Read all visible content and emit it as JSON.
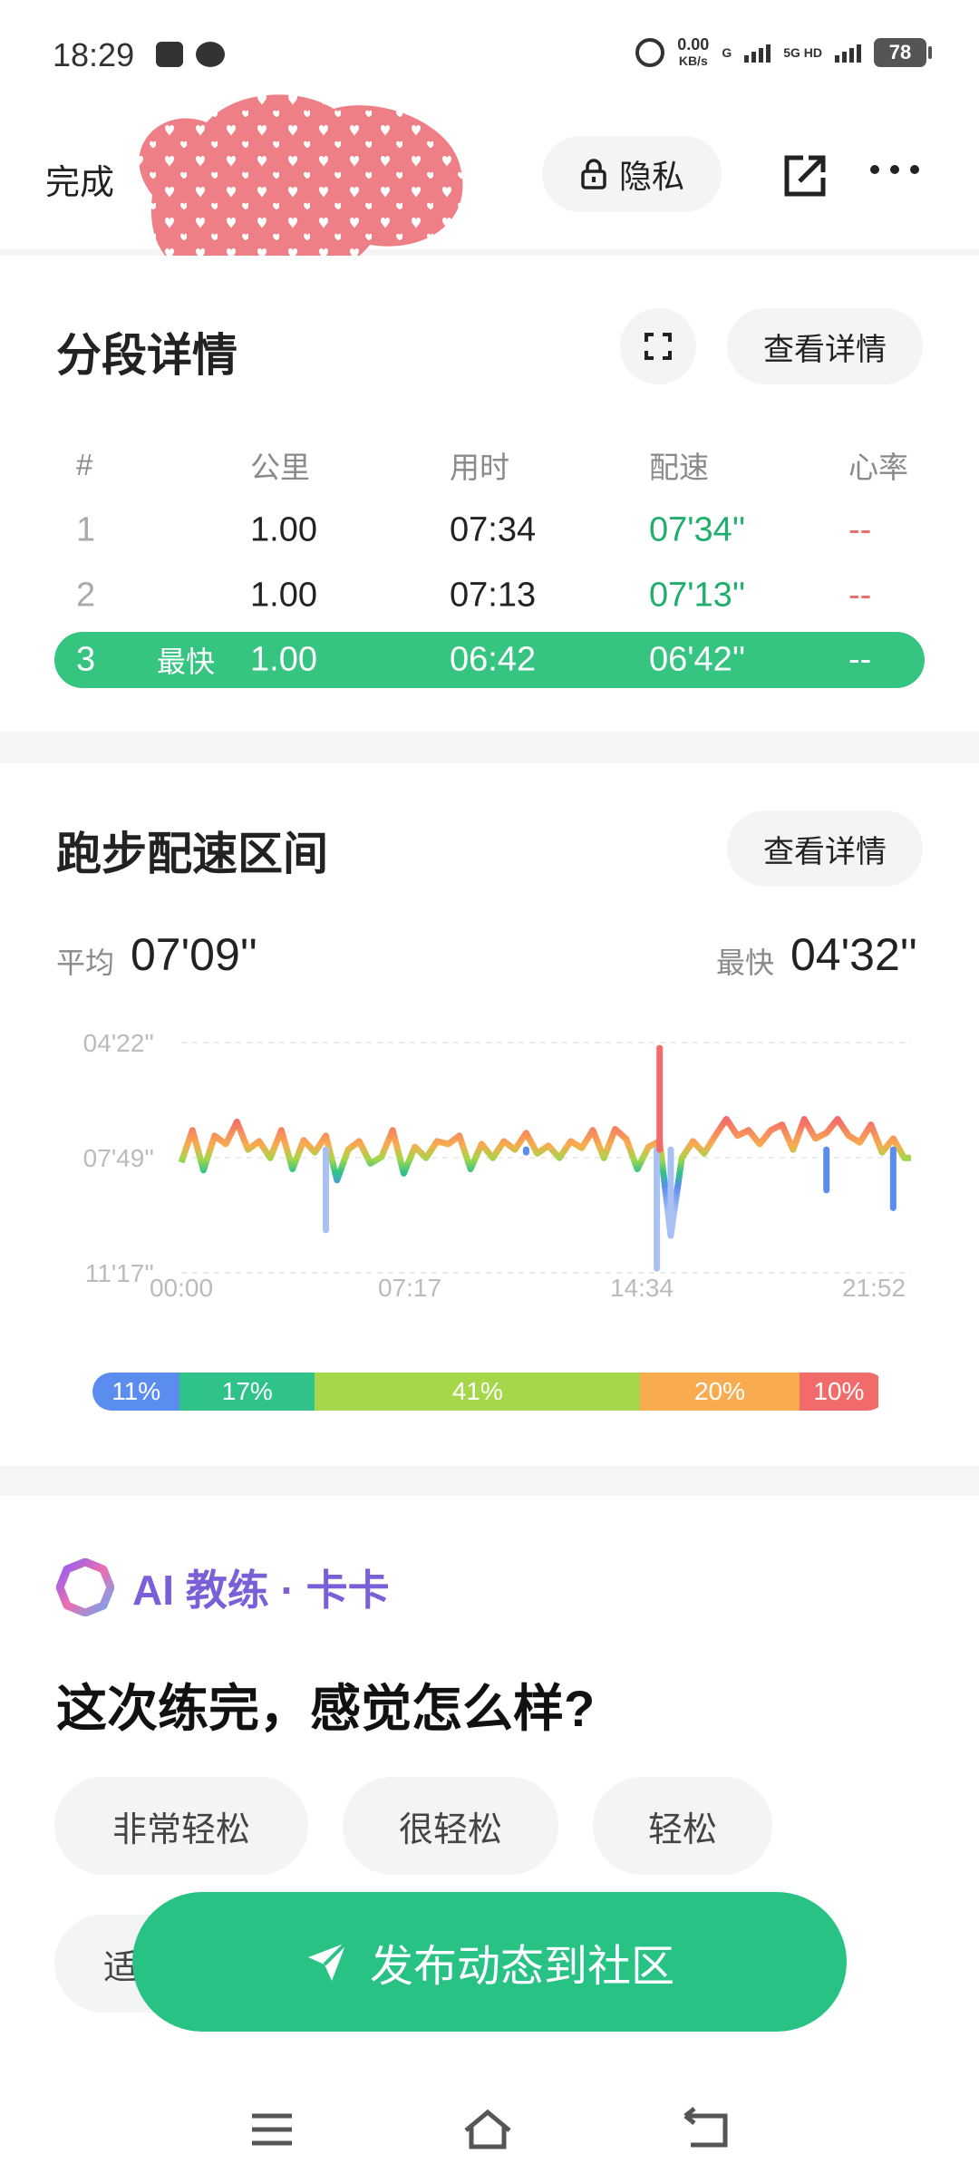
{
  "status_bar": {
    "time": "18:29",
    "speed_value": "0.00",
    "speed_unit": "KB/s",
    "net_left": "G",
    "net_right": "5G HD",
    "battery": "78"
  },
  "top_nav": {
    "done_label": "完成",
    "privacy_label": "隐私",
    "icons": [
      "lock-icon",
      "share-icon",
      "more-icon"
    ]
  },
  "segments": {
    "title": "分段详情",
    "detail_label": "查看详情",
    "headers": [
      "#",
      "公里",
      "用时",
      "配速",
      "心率"
    ],
    "rows": [
      {
        "index": "1",
        "tag": "",
        "distance": "1.00",
        "time": "07:34",
        "pace": "07'34''",
        "heart_rate": "--"
      },
      {
        "index": "2",
        "tag": "",
        "distance": "1.00",
        "time": "07:13",
        "pace": "07'13''",
        "heart_rate": "--"
      },
      {
        "index": "3",
        "tag": "最快",
        "distance": "1.00",
        "time": "06:42",
        "pace": "06'42''",
        "heart_rate": "--"
      }
    ]
  },
  "pace_zone": {
    "title": "跑步配速区间",
    "detail_label": "查看详情",
    "avg_label": "平均",
    "avg_value": "07'09''",
    "best_label": "最快",
    "best_value": "04'32''",
    "zones": [
      {
        "label": "11%",
        "percent": 11,
        "color": "#5b8def"
      },
      {
        "label": "17%",
        "percent": 17,
        "color": "#2fc38a"
      },
      {
        "label": "41%",
        "percent": 41,
        "color": "#a6d64a"
      },
      {
        "label": "20%",
        "percent": 20,
        "color": "#f9ab4f"
      },
      {
        "label": "10%",
        "percent": 10,
        "color": "#f26b6b"
      }
    ]
  },
  "chart_data": {
    "type": "line",
    "title": "",
    "xlabel": "",
    "ylabel": "",
    "x_tick_labels": [
      "00:00",
      "07:17",
      "14:34",
      "21:52"
    ],
    "y_tick_labels": [
      "04'22''",
      "07'49''",
      "11'17''"
    ],
    "x_unit": "minutes",
    "y_unit": "pace (seconds per km)",
    "xlim": [
      0,
      1312
    ],
    "ylim_top_fast": 262,
    "ylim_bottom_slow": 677,
    "series": [
      {
        "values": [
          [
            0,
            478
          ],
          [
            20,
            420
          ],
          [
            40,
            492
          ],
          [
            60,
            430
          ],
          [
            80,
            445
          ],
          [
            100,
            405
          ],
          [
            120,
            455
          ],
          [
            140,
            440
          ],
          [
            160,
            470
          ],
          [
            180,
            420
          ],
          [
            200,
            490
          ],
          [
            220,
            438
          ],
          [
            240,
            460
          ],
          [
            260,
            430
          ],
          [
            280,
            510
          ],
          [
            300,
            455
          ],
          [
            320,
            440
          ],
          [
            340,
            480
          ],
          [
            360,
            468
          ],
          [
            380,
            420
          ],
          [
            400,
            498
          ],
          [
            420,
            450
          ],
          [
            440,
            470
          ],
          [
            460,
            440
          ],
          [
            480,
            445
          ],
          [
            500,
            430
          ],
          [
            520,
            490
          ],
          [
            540,
            445
          ],
          [
            560,
            470
          ],
          [
            580,
            440
          ],
          [
            600,
            455
          ],
          [
            620,
            425
          ],
          [
            640,
            462
          ],
          [
            660,
            448
          ],
          [
            680,
            470
          ],
          [
            700,
            440
          ],
          [
            720,
            452
          ],
          [
            740,
            420
          ],
          [
            760,
            470
          ],
          [
            780,
            418
          ],
          [
            800,
            436
          ],
          [
            820,
            490
          ],
          [
            840,
            450
          ],
          [
            860,
            440
          ],
          [
            880,
            610
          ],
          [
            900,
            470
          ],
          [
            920,
            440
          ],
          [
            940,
            462
          ],
          [
            960,
            430
          ],
          [
            980,
            400
          ],
          [
            1000,
            430
          ],
          [
            1020,
            420
          ],
          [
            1040,
            445
          ],
          [
            1060,
            420
          ],
          [
            1080,
            410
          ],
          [
            1100,
            455
          ],
          [
            1120,
            400
          ],
          [
            1140,
            435
          ],
          [
            1160,
            425
          ],
          [
            1180,
            400
          ],
          [
            1200,
            430
          ],
          [
            1220,
            442
          ],
          [
            1240,
            410
          ],
          [
            1260,
            460
          ],
          [
            1280,
            435
          ],
          [
            1300,
            470
          ],
          [
            1312,
            470
          ]
        ]
      }
    ],
    "extremes": [
      [
        855,
        669
      ],
      [
        860,
        272
      ],
      [
        880,
        610
      ],
      [
        260,
        600
      ],
      [
        620,
        460
      ],
      [
        1160,
        528
      ],
      [
        1280,
        560
      ]
    ]
  },
  "coach": {
    "title": "AI 教练 · 卡卡",
    "question": "这次练完，感觉怎么样?",
    "options": [
      "非常轻松",
      "很轻松",
      "轻松",
      "适"
    ]
  },
  "publish": {
    "label": "发布动态到社区"
  }
}
